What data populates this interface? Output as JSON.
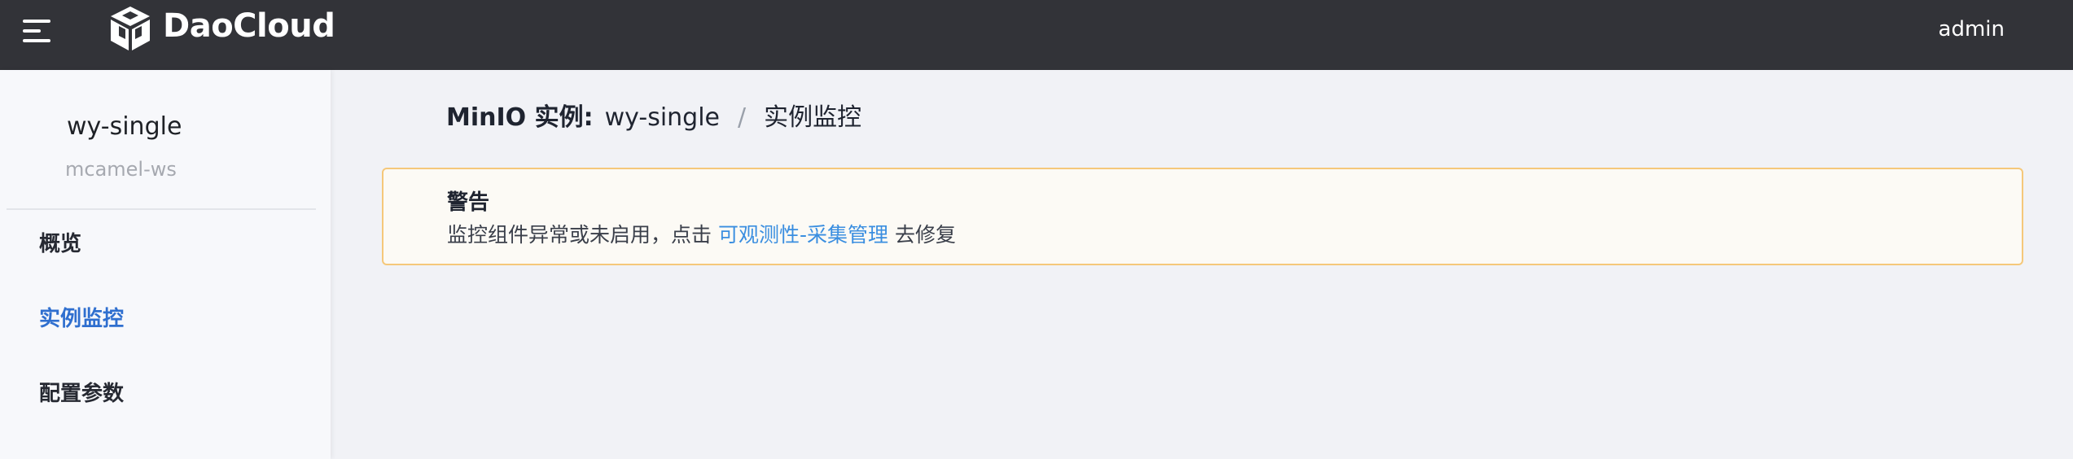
{
  "header": {
    "logo_text": "DaoCloud",
    "user_name": "admin",
    "menu_icon": "hamburger-menu-icon",
    "logo_icon": "daocloud-cube-logo"
  },
  "sidebar": {
    "title": "wy-single",
    "subtitle": "mcamel-ws",
    "items": [
      {
        "label": "概览",
        "active": false
      },
      {
        "label": "实例监控",
        "active": true
      },
      {
        "label": "配置参数",
        "active": false
      }
    ],
    "active_color": "#2f6fcf"
  },
  "breadcrumb": {
    "root": "MinIO 实例:",
    "instance": "wy-single",
    "separator": "/",
    "current": "实例监控"
  },
  "alert": {
    "title": "警告",
    "message_prefix": "监控组件异常或未启用，点击",
    "link_text": "可观测性-采集管理",
    "message_suffix": "去修复",
    "border_color": "#f5c87a",
    "link_color": "#3a8ee0"
  },
  "colors": {
    "topbar": "#323338",
    "background": "#f1f2f6",
    "sidebar": "#f7f8fb"
  }
}
